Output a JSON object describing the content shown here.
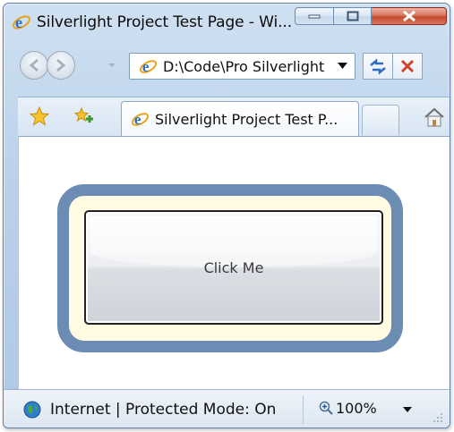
{
  "window": {
    "title": "Silverlight Project Test Page - Wi..."
  },
  "caption_buttons": {
    "minimize": "minimize",
    "maximize": "maximize",
    "close": "close"
  },
  "address": {
    "value": "D:\\Code\\Pro Silverlight"
  },
  "tab": {
    "active_label": "Silverlight Project Test P..."
  },
  "content": {
    "button_label": "Click Me"
  },
  "status": {
    "zone_text": "Internet | Protected Mode: On",
    "zoom": "100%"
  },
  "colors": {
    "frame_border": "#6b8db3",
    "frame_background": "#fffbe3",
    "close_button": "#c44a2e"
  },
  "icons": [
    "ie-logo-icon",
    "back-arrow-icon",
    "forward-arrow-icon",
    "chevron-down-icon",
    "refresh-icon",
    "stop-icon",
    "favorites-star-icon",
    "add-favorites-icon",
    "home-icon",
    "globe-icon",
    "zoom-icon",
    "resize-grip-icon"
  ]
}
